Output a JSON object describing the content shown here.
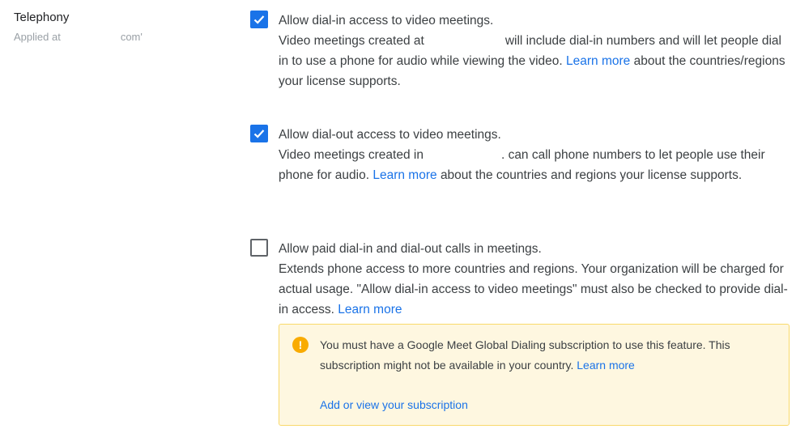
{
  "section": {
    "title": "Telephony",
    "applied_prefix": "Applied at",
    "applied_suffix": "com'"
  },
  "settings": [
    {
      "checked": true,
      "label": "Allow dial-in access to video meetings.",
      "desc_before": "Video meetings created at",
      "desc_after": "will include dial-in numbers and will let people dial in to use a phone for audio while viewing the video.",
      "link": "Learn more",
      "desc_end": "about the countries/regions your license supports."
    },
    {
      "checked": true,
      "label": "Allow dial-out access to video meetings.",
      "desc_before": "Video meetings created in",
      "desc_after": ". can call phone numbers to let people use their phone for audio.",
      "link": "Learn more",
      "desc_end": "about the countries and regions your license supports."
    },
    {
      "checked": false,
      "label": "Allow paid dial-in and dial-out calls in meetings.",
      "desc": "Extends phone access to more countries and regions. Your organization will be charged for actual usage. \"Allow dial-in access to video meetings\" must also be checked to provide dial-in access.",
      "link": "Learn more"
    }
  ],
  "notice": {
    "icon": "warning-icon",
    "icon_glyph": "!",
    "text": "You must have a Google Meet Global Dialing subscription to use this feature. This subscription might not be available in your country.",
    "link": "Learn more",
    "action": "Add or view your subscription"
  },
  "colors": {
    "accent": "#1a73e8",
    "notice_bg": "#fef7e0",
    "notice_border": "#f9d96b",
    "warning": "#f9ab00"
  }
}
